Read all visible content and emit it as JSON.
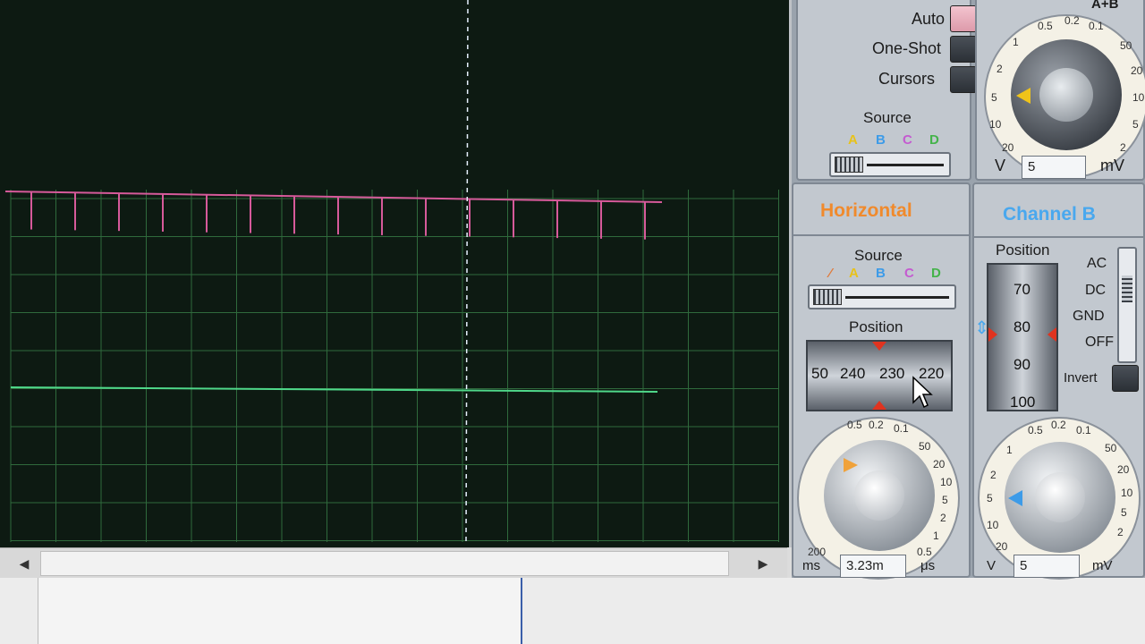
{
  "trigger": {
    "auto_label": "Auto",
    "oneshot_label": "One-Shot",
    "cursors_label": "Cursors",
    "source_label": "Source",
    "source_letters": [
      "A",
      "B",
      "C",
      "D"
    ]
  },
  "channel_a": {
    "header_partial": "A+B",
    "scale_values": [
      "0.5",
      "0.2",
      "0.1",
      "1",
      "2",
      "5",
      "10",
      "20",
      "50",
      "20",
      "10",
      "5",
      "2"
    ],
    "unit_left": "V",
    "unit_right": "mV",
    "value": "5"
  },
  "horizontal": {
    "title": "Horizontal",
    "source_label": "Source",
    "source_letters": [
      "A",
      "B",
      "C",
      "D"
    ],
    "position_label": "Position",
    "position_numbers": [
      "50",
      "240",
      "230",
      "220"
    ],
    "scale_values": [
      "0.5",
      "0.2",
      "0.1",
      "50",
      "20",
      "10",
      "5",
      "2",
      "1",
      "0.5"
    ],
    "unit_left": "ms",
    "unit_right": "μs",
    "left_value": "200",
    "value": "3.23m"
  },
  "channel_b": {
    "title": "Channel B",
    "position_label": "Position",
    "position_numbers": [
      "70",
      "80",
      "90",
      "100"
    ],
    "coupling": [
      "AC",
      "DC",
      "GND",
      "OFF"
    ],
    "invert_label": "Invert",
    "scale_values": [
      "0.5",
      "0.2",
      "0.1",
      "50",
      "20",
      "10",
      "5",
      "2",
      "1",
      "2",
      "5",
      "10",
      "20"
    ],
    "unit_left": "V",
    "unit_right": "mV",
    "value": "5"
  },
  "colors": {
    "trace_a": "#d65a9a",
    "trace_b": "#4fd88a",
    "grid": "#2f6a3c",
    "cursor": "#e6f0ff",
    "accent_orange": "#f08a2c",
    "accent_blue": "#49a8ee"
  },
  "icons": {
    "scroll_left": "◀",
    "scroll_right": "▶"
  }
}
